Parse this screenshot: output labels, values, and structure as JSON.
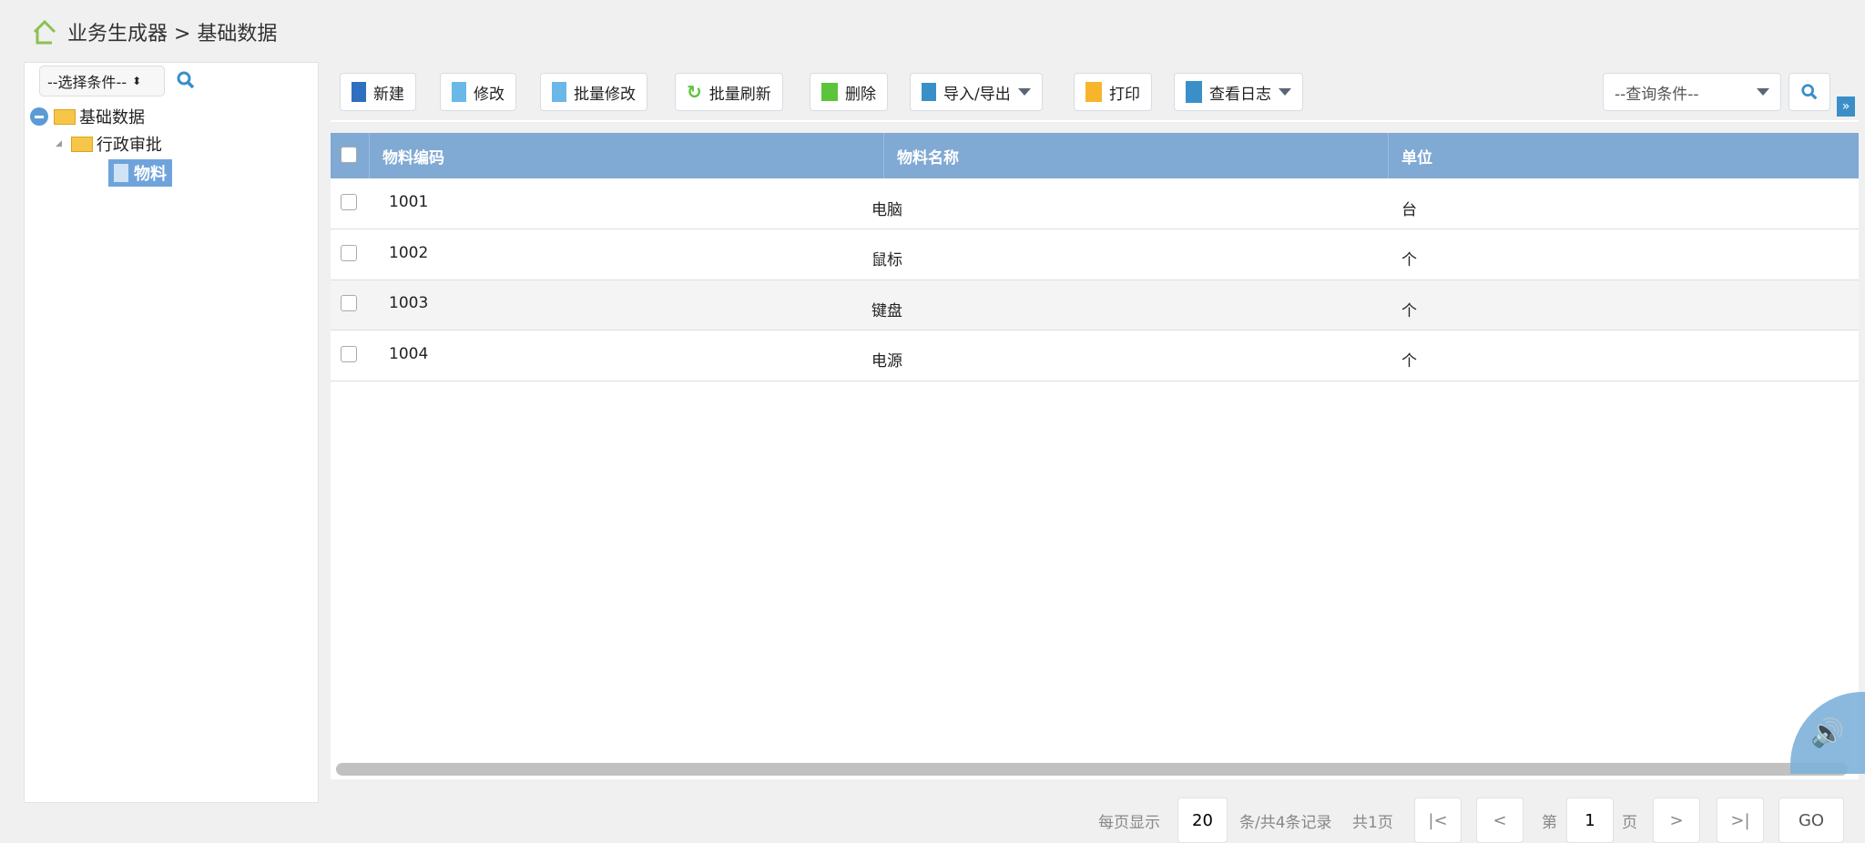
{
  "breadcrumb": {
    "text": "业务生成器 > 基础数据"
  },
  "left": {
    "select_value": "--选择条件--",
    "tree": {
      "root": "基础数据",
      "child": "行政审批",
      "leaf": "物料"
    }
  },
  "toolbar": {
    "new": "新建",
    "edit": "修改",
    "batch_edit": "批量修改",
    "batch_refresh": "批量刷新",
    "delete": "删除",
    "import_export": "导入/导出",
    "print": "打印",
    "view_log": "查看日志",
    "query_select": "--查询条件--"
  },
  "table": {
    "columns": [
      "物料编码",
      "物料名称",
      "单位"
    ],
    "rows": [
      [
        "1001",
        "电脑",
        "台"
      ],
      [
        "1002",
        "鼠标",
        "个"
      ],
      [
        "1003",
        "键盘",
        "个"
      ],
      [
        "1004",
        "电源",
        "个"
      ]
    ]
  },
  "pager": {
    "per_page_label": "每页显示",
    "per_page": "20",
    "records": "条/共4条记录",
    "pages": "共1页",
    "page_prefix": "第",
    "page": "1",
    "page_suffix": "页",
    "go": "GO"
  },
  "colors": {
    "header": "#80a9d4",
    "selected": "#6fa3dc"
  }
}
